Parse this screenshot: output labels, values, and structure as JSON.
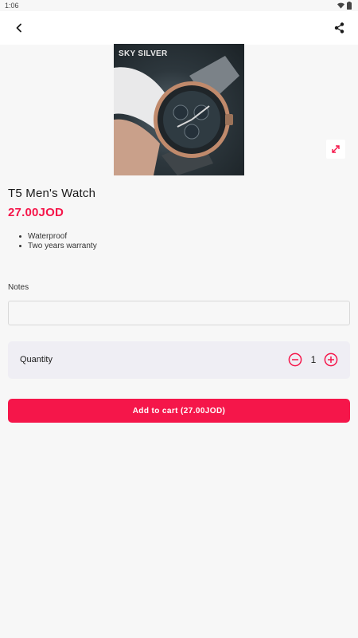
{
  "status_bar": {
    "time": "1:06",
    "icons": [
      "wifi-icon",
      "battery-icon"
    ]
  },
  "app_bar": {
    "back_icon": "chevron-left-icon",
    "share_icon": "share-icon"
  },
  "product": {
    "image_brand_text": "SKY SILVER",
    "expand_icon": "expand-icon",
    "title": "T5 Men's Watch",
    "price": "27.00JOD",
    "features": [
      "Waterproof",
      "Two years warranty"
    ]
  },
  "notes": {
    "label": "Notes",
    "value": "",
    "placeholder": ""
  },
  "quantity": {
    "label": "Quantity",
    "value": "1",
    "minus_icon": "minus-circle-icon",
    "plus_icon": "plus-circle-icon"
  },
  "cart": {
    "button_label": "Add to cart (27.00JOD)"
  },
  "colors": {
    "accent": "#f5164a",
    "background": "#f7f7f7",
    "card": "#efeef4"
  }
}
